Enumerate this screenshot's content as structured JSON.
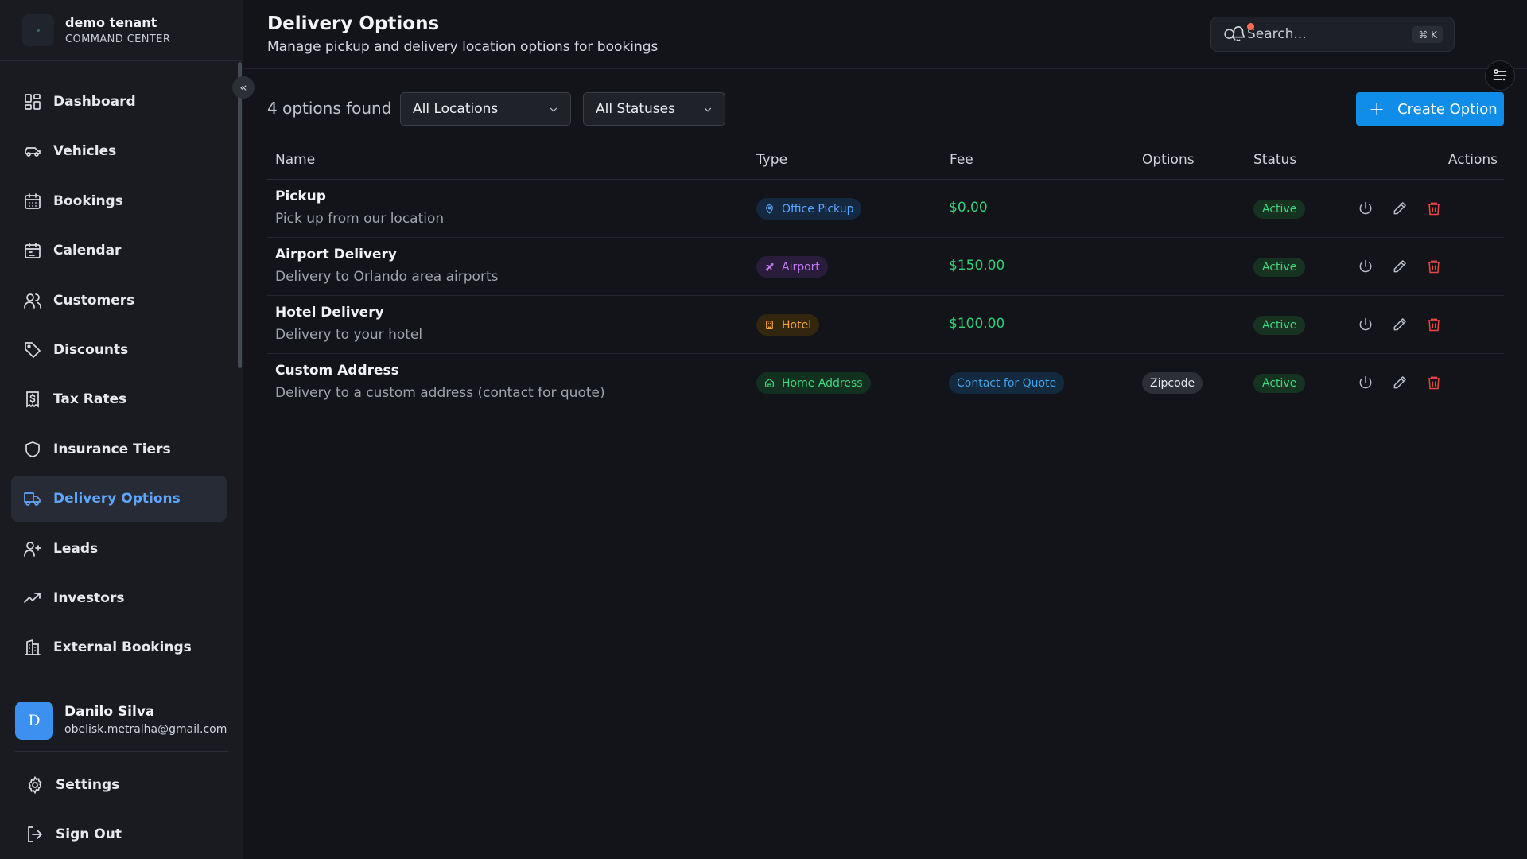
{
  "brand": {
    "title": "demo tenant",
    "subtitle": "COMMAND CENTER"
  },
  "sidebar": {
    "collapse_glyph": "«",
    "items": [
      {
        "label": "Dashboard",
        "icon": "dashboard-icon"
      },
      {
        "label": "Vehicles",
        "icon": "car-icon"
      },
      {
        "label": "Bookings",
        "icon": "calendar-days-icon"
      },
      {
        "label": "Calendar",
        "icon": "calendar-icon"
      },
      {
        "label": "Customers",
        "icon": "users-icon"
      },
      {
        "label": "Discounts",
        "icon": "tag-icon"
      },
      {
        "label": "Tax Rates",
        "icon": "receipt-dollar-icon"
      },
      {
        "label": "Insurance Tiers",
        "icon": "shield-icon"
      },
      {
        "label": "Delivery Options",
        "icon": "truck-icon",
        "active": true
      },
      {
        "label": "Leads",
        "icon": "user-plus-icon"
      },
      {
        "label": "Investors",
        "icon": "trending-up-icon"
      },
      {
        "label": "External Bookings",
        "icon": "building-icon"
      }
    ]
  },
  "user": {
    "initial": "D",
    "name": "Danilo Silva",
    "email": "obelisk.metralha@gmail.com"
  },
  "bottom": {
    "settings": "Settings",
    "sign_out": "Sign Out"
  },
  "header": {
    "title": "Delivery Options",
    "subtitle": "Manage pickup and delivery location options for bookings",
    "search_placeholder": "Search...",
    "search_shortcut": "⌘ K"
  },
  "toolbar": {
    "count_text": "4 options found",
    "location_filter": "All Locations",
    "status_filter": "All Statuses",
    "create_label": "Create Option"
  },
  "table": {
    "columns": {
      "name": "Name",
      "type": "Type",
      "fee": "Fee",
      "options": "Options",
      "status": "Status",
      "actions": "Actions"
    },
    "rows": [
      {
        "name": "Pickup",
        "description": "Pick up from our location",
        "type": "Office Pickup",
        "type_icon": "map-pin-icon",
        "fee": "$0.00",
        "options": "",
        "status": "Active"
      },
      {
        "name": "Airport Delivery",
        "description": "Delivery to Orlando area airports",
        "type": "Airport",
        "type_icon": "plane-icon",
        "fee": "$150.00",
        "options": "",
        "status": "Active"
      },
      {
        "name": "Hotel Delivery",
        "description": "Delivery to your hotel",
        "type": "Hotel",
        "type_icon": "hotel-icon",
        "fee": "$100.00",
        "options": "",
        "status": "Active"
      },
      {
        "name": "Custom Address",
        "description": "Delivery to a custom address (contact for quote)",
        "type": "Home Address",
        "type_icon": "home-icon",
        "fee": "Contact for Quote",
        "options": "Zipcode",
        "status": "Active"
      }
    ]
  },
  "colors": {
    "accent": "#0f8de8",
    "active_nav": "#5ea6ff",
    "fee_green": "#2fd17a",
    "status_green": "#3fd67e",
    "delete_red": "#ef4444",
    "notification_dot": "#ff6a55"
  }
}
